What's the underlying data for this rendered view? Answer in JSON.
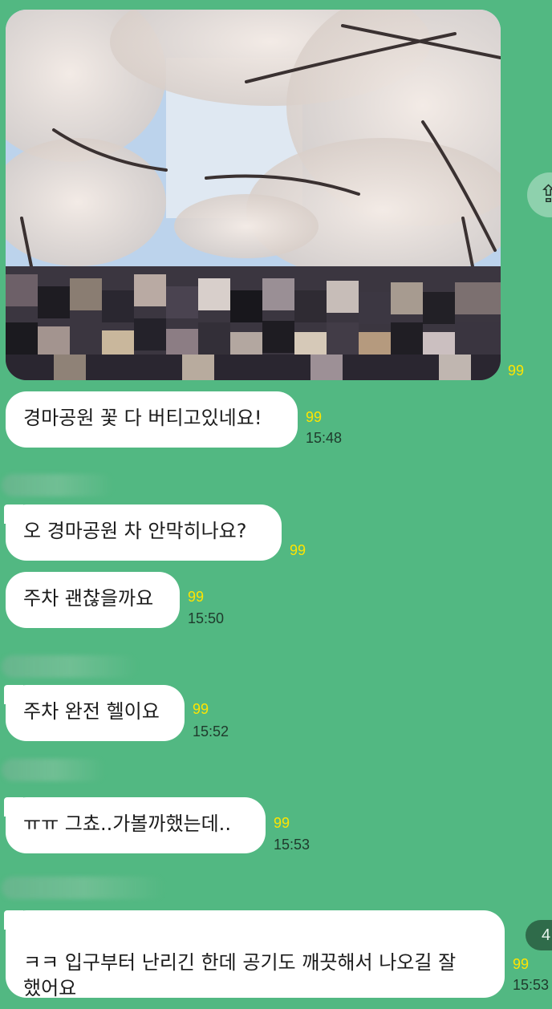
{
  "chat": {
    "photo_message": {
      "unread": "99"
    },
    "messages": [
      {
        "text": "경마공원 꽃 다 버티고있네요!",
        "unread": "99",
        "time": "15:48"
      },
      {
        "text": "오 경마공원 차 안막히나요?",
        "unread": "99"
      },
      {
        "text": "주차 괜찮을까요",
        "unread": "99",
        "time": "15:50"
      },
      {
        "text": "주차 완전 헬이요",
        "unread": "99",
        "time": "15:52"
      },
      {
        "text": "ㅠㅠ 그쵸..가볼까했는데..",
        "unread": "99",
        "time": "15:53"
      },
      {
        "text": "ㅋㅋ 입구부터 난리긴 한데 공기도 깨끗해서 나오길 잘\n했어요",
        "unread": "99",
        "time": "15:53"
      }
    ],
    "side_button_icon": "share-icon",
    "new_count": "4"
  },
  "colors": {
    "background": "#52b882",
    "bubble": "#ffffff",
    "unread": "#ffe400"
  }
}
